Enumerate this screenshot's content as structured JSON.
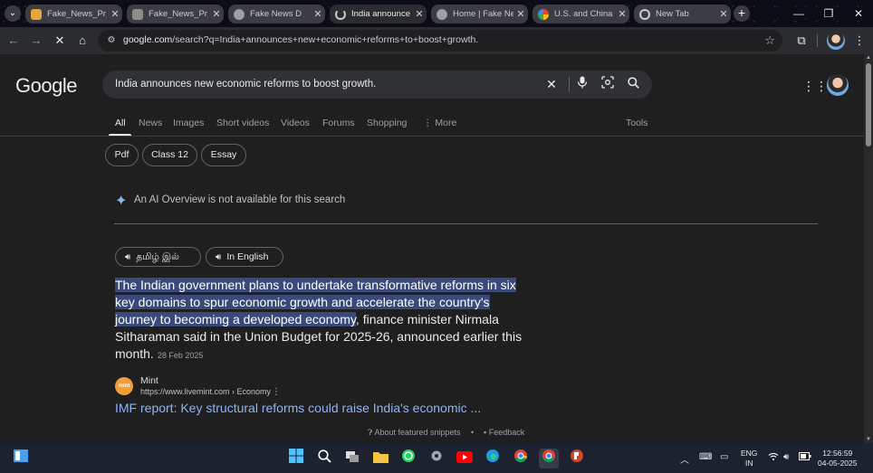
{
  "browser": {
    "tabs": [
      {
        "title": "Fake_News_Pr",
        "active": false
      },
      {
        "title": "Fake_News_Pr",
        "active": false
      },
      {
        "title": "Fake News D",
        "active": false
      },
      {
        "title": "India announce",
        "active": true
      },
      {
        "title": "Home | Fake Ne",
        "active": false
      },
      {
        "title": "U.S. and China",
        "active": false
      },
      {
        "title": "New Tab",
        "active": false
      }
    ],
    "new_tab": "+",
    "url_host": "google.com",
    "url_path": "/search?q=India+announces+new+economic+reforms+to+boost+growth."
  },
  "google": {
    "logo": "Google",
    "query": "India announces new economic reforms to boost growth.",
    "nav_tabs": [
      "All",
      "News",
      "Images",
      "Short videos",
      "Videos",
      "Forums",
      "Shopping",
      "⋮ More"
    ],
    "tools": "Tools",
    "chips": [
      "Pdf",
      "Class 12",
      "Essay"
    ],
    "ai_overview": "An AI Overview is not available for this search",
    "lang_buttons": [
      "தமிழ் இல்",
      "In English"
    ],
    "snippet_highlight": "The Indian government plans to undertake transformative reforms in six key domains to spur economic growth and accelerate the country's journey to becoming a developed economy",
    "snippet_rest": ", finance minister Nirmala Sitharaman said in the Union Budget for 2025-26, announced earlier this month.",
    "snippet_date": "28 Feb 2025",
    "source_logo": "mint",
    "source_name": "Mint",
    "source_url": "https://www.livemint.com › Economy",
    "result_title": "IMF report: Key structural reforms could raise India's economic ...",
    "about_snippets": "About featured snippets",
    "feedback": "Feedback"
  },
  "taskbar": {
    "lang_line1": "ENG",
    "lang_line2": "IN",
    "time": "12:56:59",
    "date": "04-05-2025"
  },
  "colors": {
    "page_bg": "#1f1f1f",
    "link": "#8ab4f8",
    "highlight": "#394a7a"
  }
}
